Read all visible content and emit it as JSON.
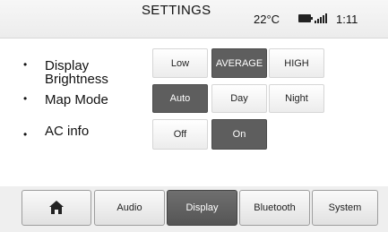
{
  "header": {
    "title": "SETTINGS",
    "temperature": "22°C",
    "battery_icon": "battery-icon",
    "signal_icon": "signal-icon",
    "time": "1:11"
  },
  "settings": {
    "display_brightness": {
      "label": "Display Brightness",
      "options": [
        "Low",
        "AVERAGE",
        "HIGH"
      ],
      "selected": "AVERAGE"
    },
    "map_mode": {
      "label": "Map Mode",
      "options": [
        "Auto",
        "Day",
        "Night"
      ],
      "selected": "Auto"
    },
    "ac_info": {
      "label": "AC info",
      "options": [
        "Off",
        "On"
      ],
      "selected": "On"
    }
  },
  "tabs": {
    "home_icon": "home-icon",
    "items": [
      "Audio",
      "Display",
      "Bluetooth",
      "System"
    ],
    "active": "Display"
  },
  "colors": {
    "selected_background": "#5e5e5e",
    "selected_text": "#ffffff"
  }
}
